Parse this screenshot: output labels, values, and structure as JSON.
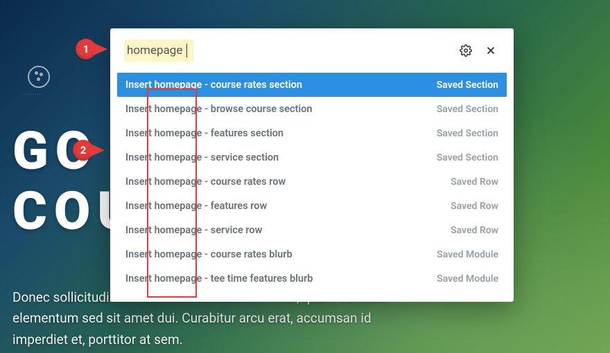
{
  "hero": {
    "title_line1": "GO",
    "title_line2": "COU",
    "body": "Donec sollicitudin .................................................. , quam vehicula elementum sed sit amet dui. Curabitur arcu erat, accumsan id imperdiet et, porttitor at sem.",
    "circle_label": "·········"
  },
  "panel": {
    "search_value": "homepage",
    "results": [
      {
        "label": "Insert homepage - course rates section",
        "tag": "Saved Section",
        "selected": true
      },
      {
        "label": "Insert homepage - browse course section",
        "tag": "Saved Section",
        "selected": false
      },
      {
        "label": "Insert homepage - features section",
        "tag": "Saved Section",
        "selected": false
      },
      {
        "label": "Insert homepage - service section",
        "tag": "Saved Section",
        "selected": false
      },
      {
        "label": "Insert homepage - course rates row",
        "tag": "Saved Row",
        "selected": false
      },
      {
        "label": "Insert homepage - features row",
        "tag": "Saved Row",
        "selected": false
      },
      {
        "label": "Insert homepage - service row",
        "tag": "Saved Row",
        "selected": false
      },
      {
        "label": "Insert homepage - course rates blurb",
        "tag": "Saved Module",
        "selected": false
      },
      {
        "label": "Insert homepage - tee time features blurb",
        "tag": "Saved Module",
        "selected": false
      }
    ]
  },
  "annotations": {
    "callout1": "1",
    "callout2": "2"
  }
}
